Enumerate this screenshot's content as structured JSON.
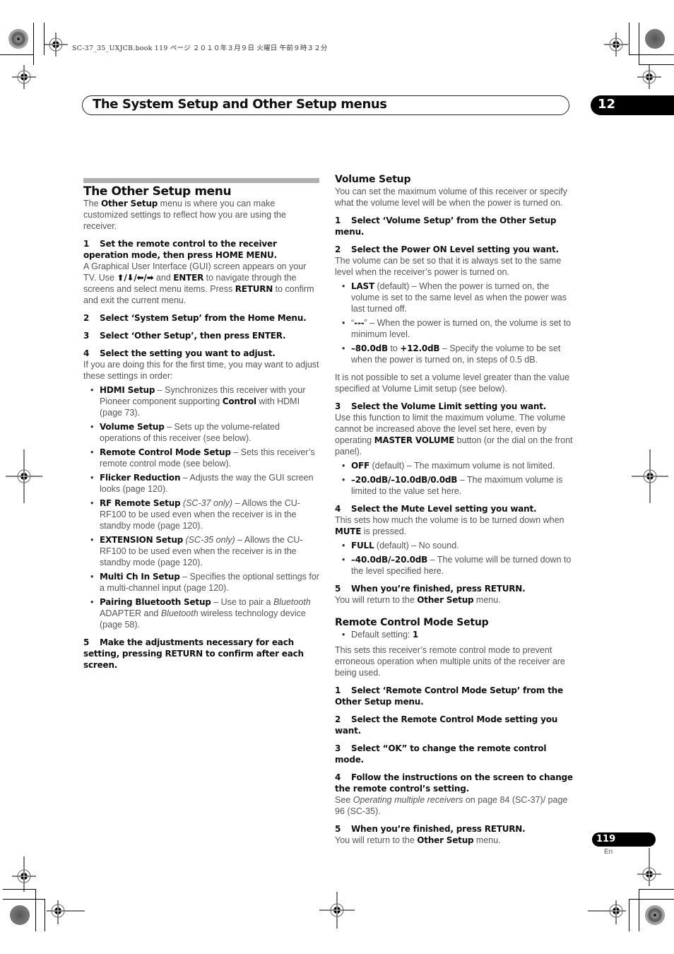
{
  "book_info": "SC-37_35_UXJCB.book  119 ページ  ２０１０年３月９日  火曜日  午前９時３２分",
  "header": {
    "title": "The System Setup and Other Setup menus",
    "chapter": "12"
  },
  "left": {
    "section_title": "The Other Setup menu",
    "intro": {
      "pre": "The ",
      "bold": "Other Setup",
      "post": " menu is where you can make customized settings to reflect how you are using the receiver."
    },
    "step1": {
      "num": "1",
      "text": "Set the remote control to the receiver operation mode, then press HOME MENU."
    },
    "step1_body": {
      "a": "A Graphical User Interface (GUI) screen appears on your TV. Use ",
      "arrows": "⬆/⬇/⬅/➡",
      "b": " and ",
      "enter": "ENTER",
      "c": " to navigate through the screens and select menu items. Press ",
      "ret": "RETURN",
      "d": " to confirm and exit the current menu."
    },
    "step2": {
      "num": "2",
      "text": "Select ‘System Setup’ from the Home Menu."
    },
    "step3": {
      "num": "3",
      "text": "Select ‘Other Setup’, then press ENTER."
    },
    "step4": {
      "num": "4",
      "text": "Select the setting you want to adjust."
    },
    "step4_body": "If you are doing this for the first time, you may want to adjust these settings in order:",
    "items": [
      {
        "bold": "HDMI Setup",
        "a": " – Synchronizes this receiver with your Pioneer component supporting ",
        "bold2": "Control",
        "b": " with HDMI (page 73)."
      },
      {
        "bold": "Volume Setup",
        "text": " – Sets up the volume-related operations of this receiver (see below)."
      },
      {
        "bold": "Remote Control Mode Setup",
        "text": " – Sets this receiver’s remote control mode (see below)."
      },
      {
        "bold": "Flicker Reduction",
        "text": " – Adjusts the way the GUI screen looks (page 120)."
      },
      {
        "bold": "RF Remote Setup",
        "italic": " (SC-37 only)",
        "text": " – Allows the CU-RF100 to be used even when the receiver is in the standby mode (page 120)."
      },
      {
        "bold": "EXTENSION Setup",
        "italic": " (SC-35 only)",
        "text": " – Allows the CU-RF100 to be used even when the receiver is in the standby mode (page 120)."
      },
      {
        "bold": "Multi Ch In Setup",
        "text": " – Specifies the optional settings for a multi-channel input (page 120)."
      },
      {
        "bold": "Pairing Bluetooth Setup",
        "a": " – Use to pair a ",
        "i1": "Bluetooth",
        "b": " ADAPTER and ",
        "i2": "Bluetooth",
        "c": " wireless technology device (page 58)."
      }
    ],
    "step5": {
      "num": "5",
      "text": "Make the adjustments necessary for each setting, pressing RETURN to confirm after each screen."
    }
  },
  "right": {
    "volume": {
      "title": "Volume Setup",
      "intro": "You can set the maximum volume of this receiver or specify what the volume level will be when the power is turned on.",
      "step1": {
        "num": "1",
        "text": "Select ‘Volume Setup’ from the Other Setup menu."
      },
      "step2": {
        "num": "2",
        "text": "Select the Power ON Level setting you want."
      },
      "step2_body": "The volume can be set so that it is always set to the same level when the receiver’s power is turned on.",
      "power_items": [
        {
          "bold": "LAST",
          "text": " (default) – When the power is turned on, the volume is set to the same level as when the power was last turned off."
        },
        {
          "pre": "“",
          "bold": "---",
          "text": "” – When the power is turned on, the volume is set to minimum level."
        },
        {
          "bold": "–80.0dB",
          "mid": " to ",
          "bold2": "+12.0dB",
          "text": " – Specify the volume to be set when the power is turned on, in steps of 0.5 dB."
        }
      ],
      "note": "It is not possible to set a volume level greater than the value specified at Volume Limit setup (see below).",
      "step3": {
        "num": "3",
        "text": "Select the Volume Limit setting you want."
      },
      "step3_body": {
        "a": "Use this function to limit the maximum volume. The volume cannot be increased above the level set here, even by operating ",
        "bold": "MASTER VOLUME",
        "b": " button (or the dial on the front panel)."
      },
      "limit_items": [
        {
          "bold": "OFF",
          "text": " (default) – The maximum volume is not limited."
        },
        {
          "bold": "–20.0dB/–10.0dB/0.0dB",
          "text": " – The maximum volume is limited to the value set here."
        }
      ],
      "step4": {
        "num": "4",
        "text": "Select the Mute Level setting you want."
      },
      "step4_body": {
        "a": "This sets how much the volume is to be turned down when ",
        "bold": "MUTE",
        "b": " is pressed."
      },
      "mute_items": [
        {
          "bold": "FULL",
          "text": " (default) – No sound."
        },
        {
          "bold": "–40.0dB/–20.0dB",
          "text": " – The volume will be turned down to the level specified here."
        }
      ],
      "step5": {
        "num": "5",
        "text": "When you’re finished, press RETURN."
      },
      "step5_body": {
        "a": "You will return to the ",
        "bold": "Other Setup",
        "b": " menu."
      }
    },
    "remote": {
      "title": "Remote Control Mode Setup",
      "default": {
        "text": "Default setting: ",
        "bold": "1"
      },
      "intro": "This sets this receiver’s remote control mode to prevent erroneous operation when multiple units of the receiver are being used.",
      "step1": {
        "num": "1",
        "text": "Select ‘Remote Control Mode Setup’ from the Other Setup menu."
      },
      "step2": {
        "num": "2",
        "text": "Select the Remote Control Mode setting you want."
      },
      "step3": {
        "num": "3",
        "text": "Select “OK” to change the remote control mode."
      },
      "step4": {
        "num": "4",
        "text": "Follow the instructions on the screen to change the remote control’s setting."
      },
      "step4_body": {
        "a": "See ",
        "italic": "Operating multiple receivers",
        "b": " on page 84 (SC-37)/ page 96 (SC-35)."
      },
      "step5": {
        "num": "5",
        "text": "When you’re finished, press RETURN."
      },
      "step5_body": {
        "a": "You will return to the ",
        "bold": "Other Setup",
        "b": " menu."
      }
    }
  },
  "footer": {
    "page": "119",
    "lang": "En"
  }
}
